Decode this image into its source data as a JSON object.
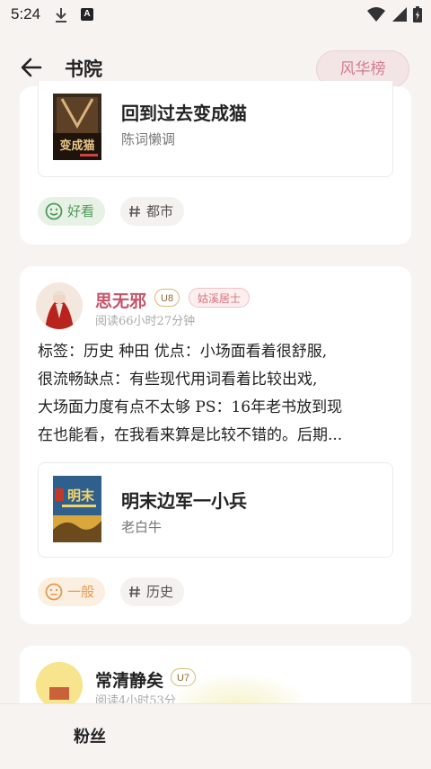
{
  "status_bar": {
    "time": "5:24",
    "a_badge": "A"
  },
  "header": {
    "title": "书院",
    "rank_button": "风华榜"
  },
  "cards": [
    {
      "book": {
        "title": "回到过去变成猫",
        "author": "陈词懒调",
        "cover_text": "变成猫"
      },
      "tags": [
        {
          "label": "好看",
          "kind": "good"
        },
        {
          "label": "都市",
          "kind": "genre"
        }
      ]
    },
    {
      "user": {
        "name": "思无邪",
        "level": "U8",
        "title": "姑溪居士",
        "read_time": "阅读66小时27分钟"
      },
      "review_lines": [
        "标签：历史 种田 优点：小场面看着很舒服,",
        "很流畅缺点：有些现代用词看着比较出戏,",
        "大场面力度有点不太够 PS：16年老书放到现",
        "在也能看，在我看来算是比较不错的。后期..."
      ],
      "book": {
        "title": "明末边军一小兵",
        "author": "老白牛",
        "cover_text": "明末"
      },
      "tags": [
        {
          "label": "一般",
          "kind": "mid"
        },
        {
          "label": "历史",
          "kind": "genre"
        }
      ]
    },
    {
      "user": {
        "name": "常清静矣",
        "level": "U7",
        "read_time": "阅读4小时53分"
      }
    }
  ],
  "bottom_bar": {
    "label": "粉丝"
  },
  "colors": {
    "good": "#4f9a57",
    "mid": "#e69a4f",
    "rank": "#d27e8c",
    "name_pink": "#c5546a"
  }
}
